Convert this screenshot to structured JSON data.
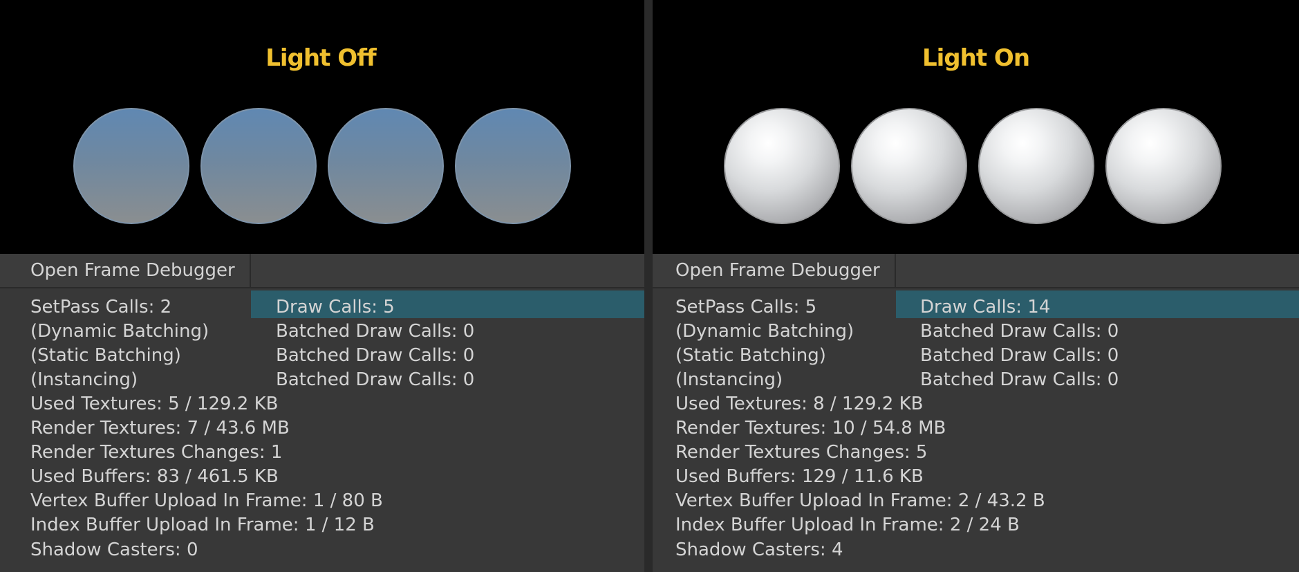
{
  "left": {
    "title": "Light Off",
    "debugger_button": "Open Frame Debugger",
    "setpass": "SetPass Calls: 2",
    "draw_calls": "Draw Calls: 5",
    "dynamic_label": "(Dynamic Batching)",
    "dynamic_value": "Batched Draw Calls: 0",
    "static_label": "(Static Batching)",
    "static_value": "Batched Draw Calls: 0",
    "instancing_label": "(Instancing)",
    "instancing_value": "Batched Draw Calls: 0",
    "used_textures": "Used Textures: 5 / 129.2 KB",
    "render_textures": "Render Textures: 7 / 43.6 MB",
    "render_textures_changes": "Render Textures Changes: 1",
    "used_buffers": "Used Buffers: 83 / 461.5 KB",
    "vertex_upload": "Vertex Buffer Upload In Frame: 1 / 80 B",
    "index_upload": "Index Buffer Upload In Frame: 1 / 12 B",
    "shadow_casters": "Shadow Casters: 0"
  },
  "right": {
    "title": "Light On",
    "debugger_button": "Open Frame Debugger",
    "setpass": "SetPass Calls: 5",
    "draw_calls": "Draw Calls: 14",
    "dynamic_label": "(Dynamic Batching)",
    "dynamic_value": "Batched Draw Calls: 0",
    "static_label": "(Static Batching)",
    "static_value": "Batched Draw Calls: 0",
    "instancing_label": "(Instancing)",
    "instancing_value": "Batched Draw Calls: 0",
    "used_textures": "Used Textures: 8 / 129.2 KB",
    "render_textures": "Render Textures: 10 / 54.8 MB",
    "render_textures_changes": "Render Textures Changes: 5",
    "used_buffers": "Used Buffers: 129 / 11.6 KB",
    "vertex_upload": "Vertex Buffer Upload In Frame: 2 / 43.2 B",
    "index_upload": "Index Buffer Upload In Frame: 2 / 24 B",
    "shadow_casters": "Shadow Casters: 4"
  },
  "colors": {
    "title": "#f0c02f",
    "highlight": "#2b5d6b",
    "text": "#d4d4d4",
    "panel_bg": "#383838"
  }
}
